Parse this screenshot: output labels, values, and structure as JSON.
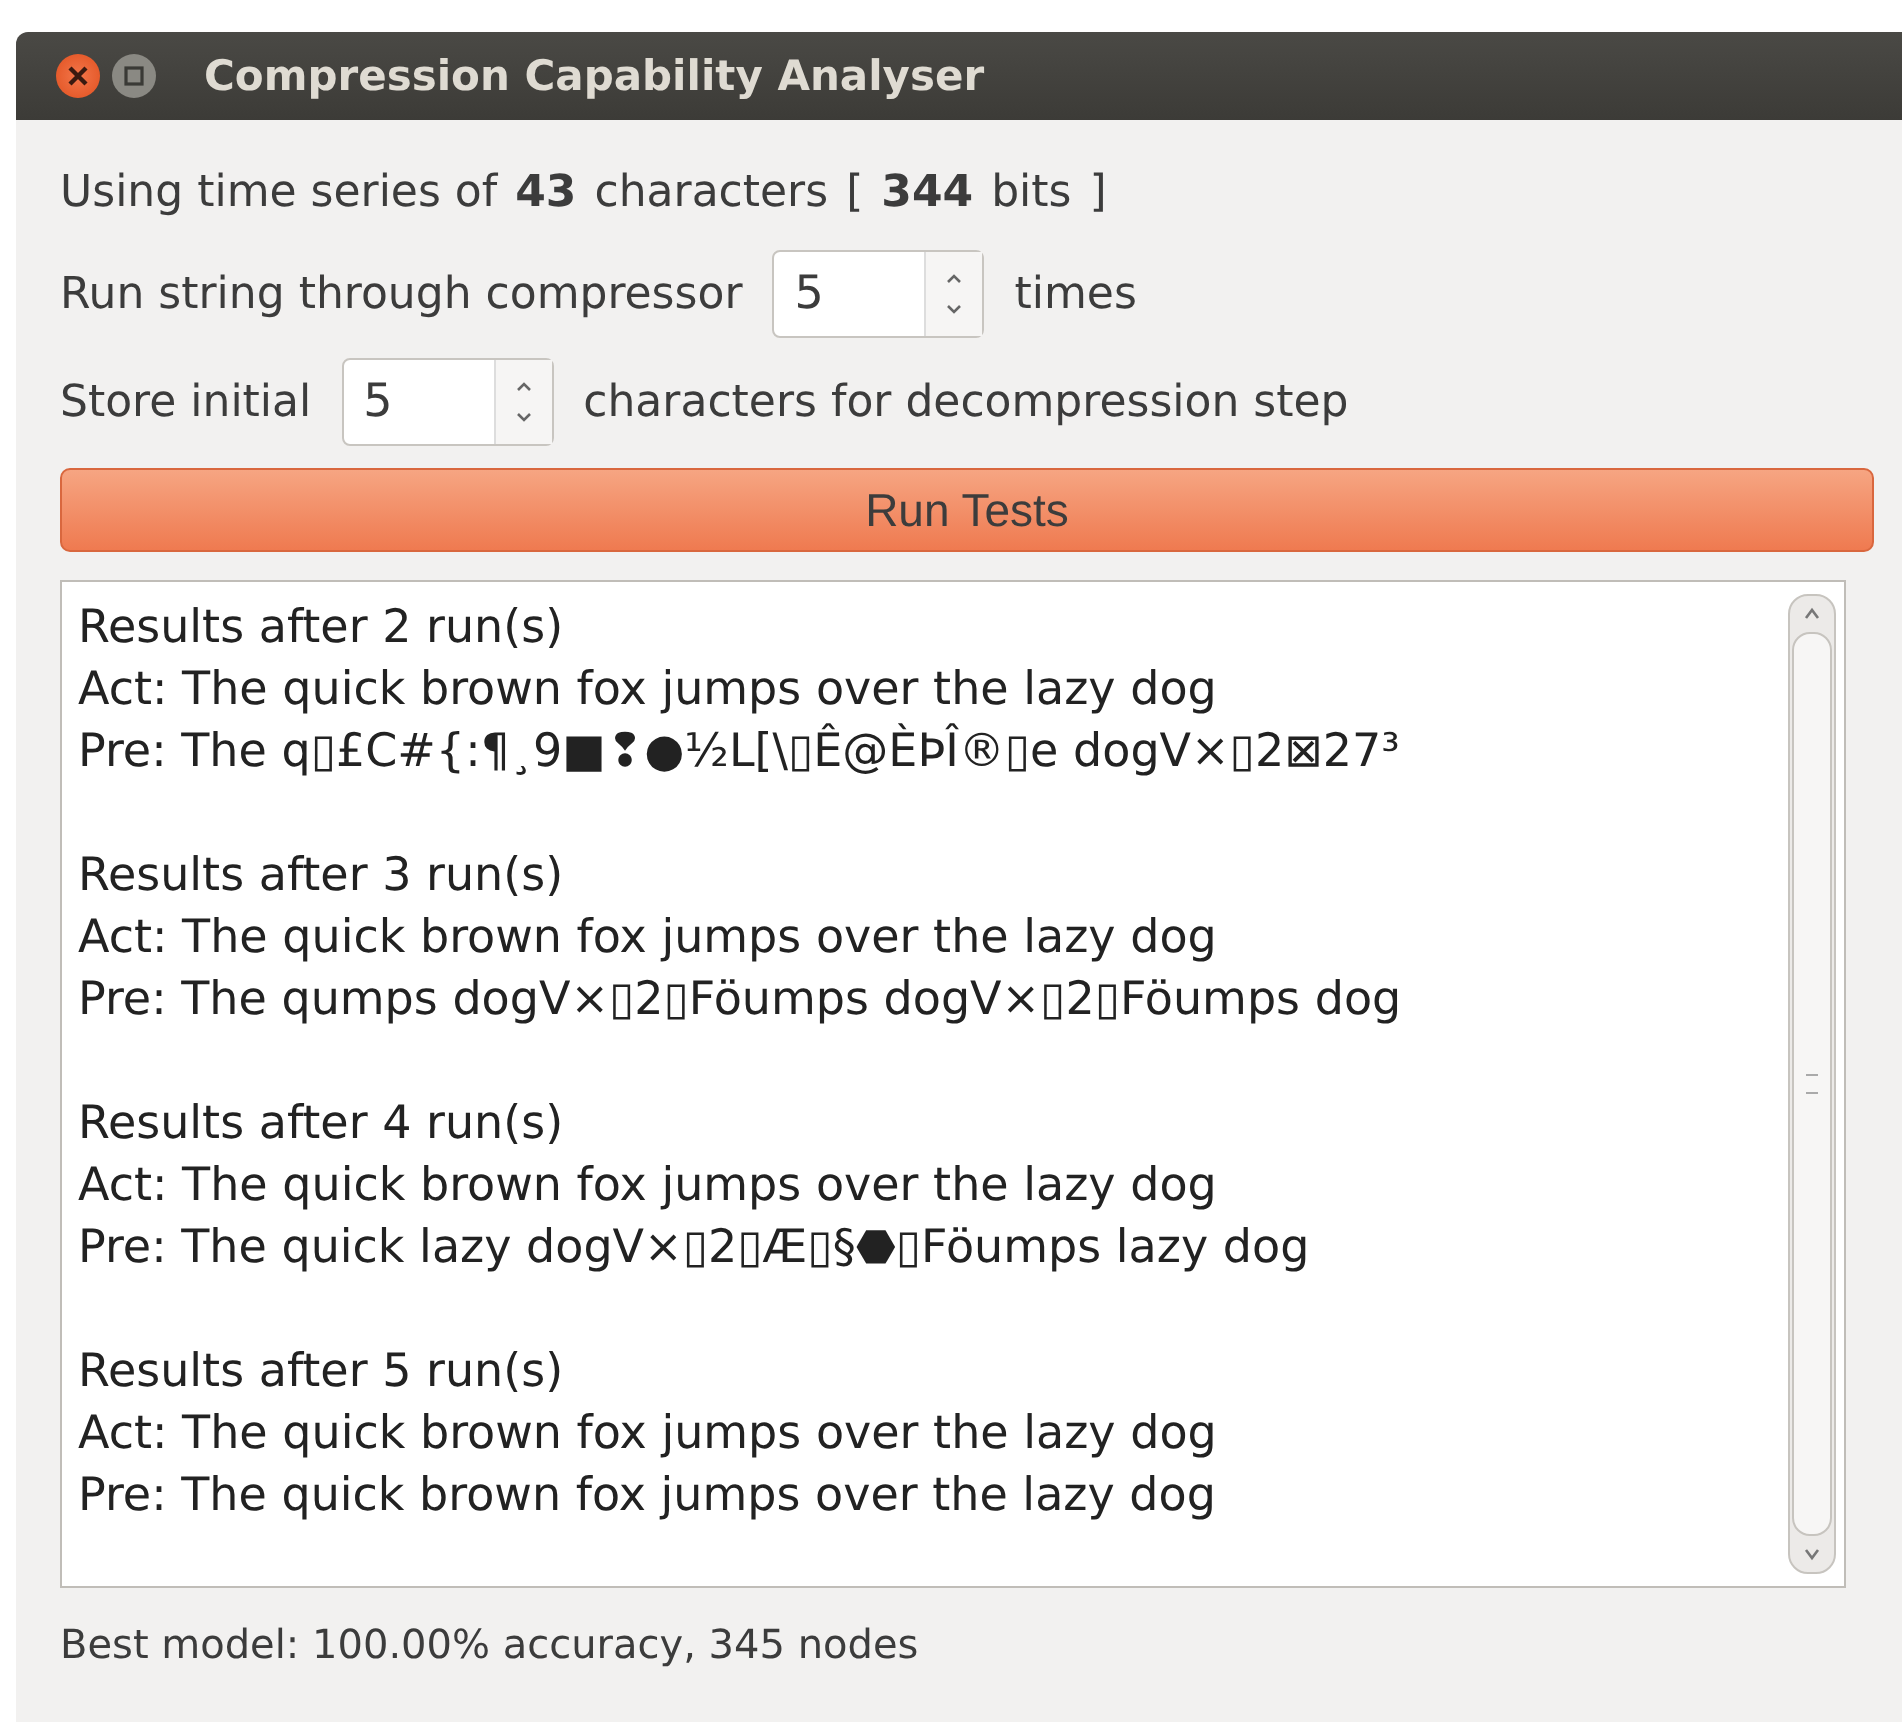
{
  "window": {
    "title": "Compression Capability Analyser"
  },
  "summary": [
    {
      "text": "Using time series of",
      "bold": false
    },
    {
      "text": "43",
      "bold": true
    },
    {
      "text": "characters",
      "bold": false
    },
    {
      "text": "[",
      "bold": false
    },
    {
      "text": "344",
      "bold": true
    },
    {
      "text": "bits",
      "bold": false
    },
    {
      "text": "]",
      "bold": false
    }
  ],
  "runs_row": {
    "before": "Run string through compressor",
    "value": "5",
    "after": "times"
  },
  "store_row": {
    "before": "Store initial",
    "value": "5",
    "after": "characters for decompression step"
  },
  "run_button": "Run Tests",
  "results": [
    {
      "title": "Results after 2 run(s)",
      "actual": "Act: The quick brown fox jumps over the lazy dog",
      "predicted": "Pre: The q▯£C#{:¶¸9■❢●½L[\\▯Ê@ÈÞÎ®▯e dogV×▯2⊠27³"
    },
    {
      "title": "Results after 3 run(s)",
      "actual": "Act: The quick brown fox jumps over the lazy dog",
      "predicted": "Pre: The qumps dogV×▯2▯Föumps dogV×▯2▯Föumps dog"
    },
    {
      "title": "Results after 4 run(s)",
      "actual": "Act: The quick brown fox jumps over the lazy dog",
      "predicted": "Pre: The quick lazy dogV×▯2▯Æ▯§⬣▯Föumps lazy dog"
    },
    {
      "title": "Results after 5 run(s)",
      "actual": "Act: The quick brown fox jumps over the lazy dog",
      "predicted": "Pre: The quick brown fox jumps over the lazy dog"
    }
  ],
  "status_bar": "Best model: 100.00% accuracy, 345 nodes"
}
